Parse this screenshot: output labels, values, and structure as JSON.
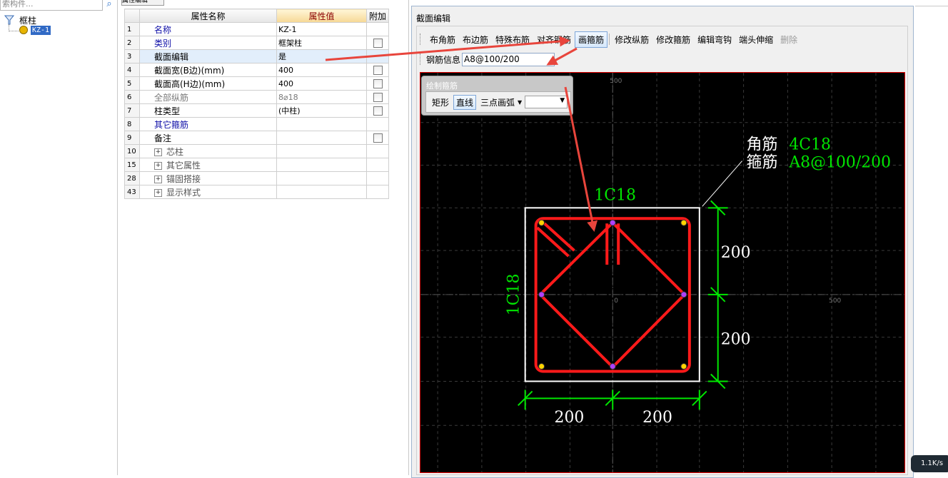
{
  "left_panel": {
    "search_placeholder": "索构件...",
    "tree_root": "框柱",
    "tree_child": "KZ-1"
  },
  "property_grid": {
    "tab_label": "属性编辑",
    "headers": {
      "name": "属性名称",
      "value": "属性值",
      "extra": "附加"
    },
    "rows": [
      {
        "index": "1",
        "name": "名称",
        "value": "KZ-1",
        "checkbox": false
      },
      {
        "index": "2",
        "name": "类别",
        "value": "框架柱",
        "checkbox": true
      },
      {
        "index": "3",
        "name": "截面编辑",
        "value": "是",
        "checkbox": false
      },
      {
        "index": "4",
        "name": "截面宽(B边)(mm)",
        "value": "400",
        "checkbox": true
      },
      {
        "index": "5",
        "name": "截面高(H边)(mm)",
        "value": "400",
        "checkbox": true
      },
      {
        "index": "6",
        "name": "全部纵筋",
        "value": "8⌀18",
        "checkbox": true
      },
      {
        "index": "7",
        "name": "柱类型",
        "value": "(中柱)",
        "checkbox": true
      },
      {
        "index": "8",
        "name": "其它箍筋",
        "value": "",
        "checkbox": false
      },
      {
        "index": "9",
        "name": "备注",
        "value": "",
        "checkbox": true
      },
      {
        "index": "10",
        "name": "芯柱",
        "value": "",
        "checkbox": false
      },
      {
        "index": "15",
        "name": "其它属性",
        "value": "",
        "checkbox": false
      },
      {
        "index": "28",
        "name": "锚固搭接",
        "value": "",
        "checkbox": false
      },
      {
        "index": "43",
        "name": "显示样式",
        "value": "",
        "checkbox": false
      }
    ]
  },
  "section_editor": {
    "title": "截面编辑",
    "toolbar": [
      "布角筋",
      "布边筋",
      "特殊布筋",
      "对齐钢筋",
      "画箍筋",
      "修改纵筋",
      "修改箍筋",
      "编辑弯钩",
      "端头伸缩",
      "删除"
    ],
    "active_tool": "画箍筋",
    "disabled_tool": "删除",
    "rebar_info_label": "钢筋信息",
    "rebar_info_value": "A8@100/200",
    "draw_panel": {
      "title": "绘制箍筋",
      "buttons": [
        "矩形",
        "直线",
        "三点画弧"
      ],
      "active": "直线",
      "combo_value": ""
    },
    "canvas": {
      "ruler_top": "500",
      "ruler_right": "500",
      "origin": "0",
      "corner_label": "角筋",
      "corner_value": "4C18",
      "stirrup_label": "箍筋",
      "stirrup_value": "A8@100/200",
      "top_edge_rebar": "1C18",
      "left_edge_rebar": "1C18",
      "dim_right_upper": "200",
      "dim_right_lower": "200",
      "dim_bottom_left": "200",
      "dim_bottom_right": "200"
    }
  },
  "status": {
    "net_speed": "1.1K/s"
  },
  "colors": {
    "canvas_bg": "#000000",
    "stirrup": "#ff1a1a",
    "dimension": "#00e600",
    "annotation_arrow": "#e8453c",
    "selected_row": "#e2eefb"
  }
}
